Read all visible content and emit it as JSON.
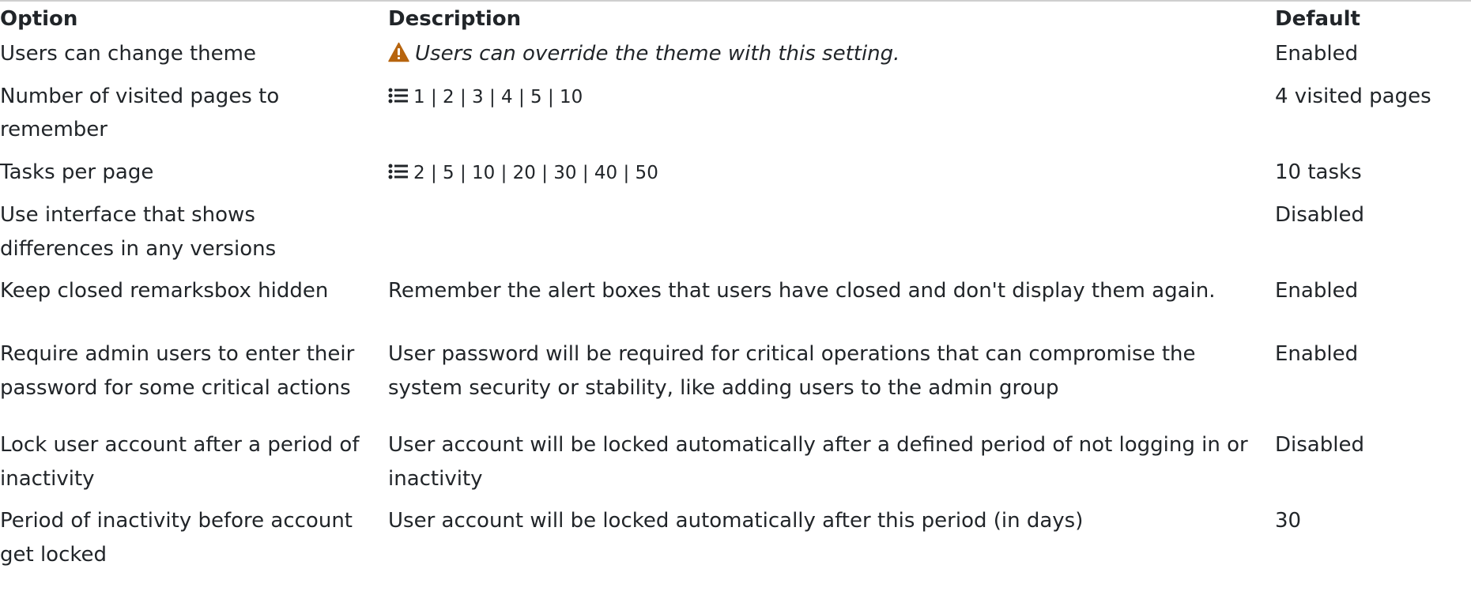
{
  "table": {
    "headers": {
      "option": "Option",
      "description": "Description",
      "default": "Default"
    },
    "rows": [
      {
        "option": "Users can change theme",
        "description": "Users can override the theme with this setting.",
        "description_icon": "warning-icon",
        "default": "Enabled"
      },
      {
        "option": "Number of visited pages to remember",
        "description": "1 | 2 | 3 | 4 | 5 | 10",
        "description_icon": "list-icon",
        "default": "4 visited pages"
      },
      {
        "option": "Tasks per page",
        "description": "2 | 5 | 10 | 20 | 30 | 40 | 50",
        "description_icon": "list-icon",
        "default": "10 tasks"
      },
      {
        "option": "Use interface that shows differences in any versions",
        "description": "",
        "default": "Disabled"
      },
      {
        "option": "Keep closed remarksbox hidden",
        "description": "Remember the alert boxes that users have closed and don't display them again.",
        "default": "Enabled"
      },
      {
        "option": "Require admin users to enter their password for some critical actions",
        "description": "User password will be required for critical operations that can compromise the system security or stability, like adding users to the admin group",
        "default": "Enabled"
      },
      {
        "option": "Lock user account after a period of inactivity",
        "description": "User account will be locked automatically after a defined period of not logging in or inactivity",
        "default": "Disabled"
      },
      {
        "option": "Period of inactivity before account get locked",
        "description": "User account will be locked automatically after this period (in days)",
        "default": "30"
      }
    ]
  },
  "colors": {
    "text": "#212529",
    "warning_icon": "#b7650f",
    "rule": "#cfcfcf"
  }
}
